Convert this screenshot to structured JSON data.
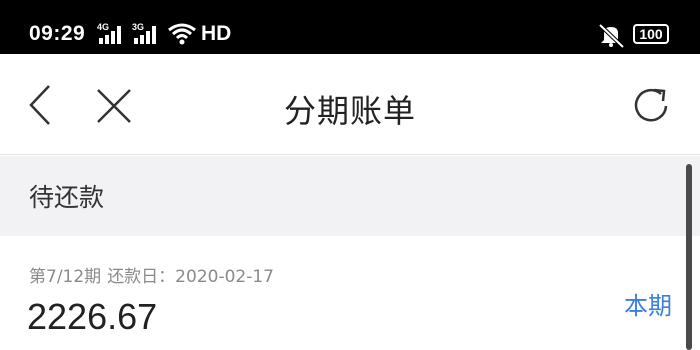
{
  "status_bar": {
    "time": "09:29",
    "signal1_label": "4G",
    "signal2_label": "3G",
    "hd_label": "HD",
    "battery": "100"
  },
  "nav": {
    "title": "分期账单",
    "back_icon": "chevron-left-icon",
    "close_icon": "close-icon",
    "refresh_icon": "refresh-icon"
  },
  "section": {
    "title": "待还款"
  },
  "bill": {
    "period": "第7/12期",
    "due_label": "还款日：2020-02-17",
    "amount": "2226.67",
    "tag": "本期",
    "tag_color": "#3a7fe0"
  }
}
